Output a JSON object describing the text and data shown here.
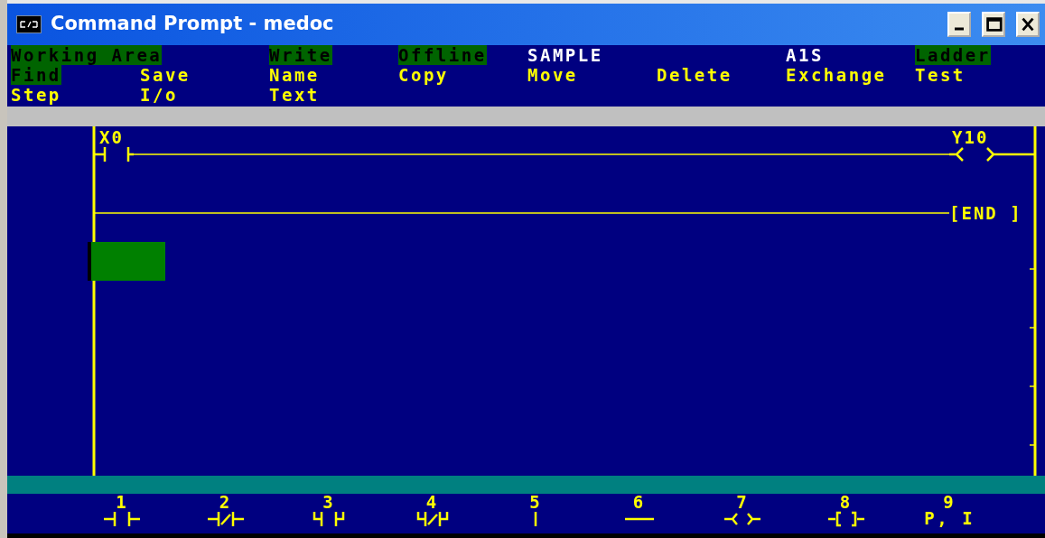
{
  "window": {
    "title": "Command Prompt - medoc"
  },
  "menu_rows": [
    [
      {
        "label": "Working Area",
        "kind": "highlight"
      },
      null,
      {
        "label": "Write",
        "kind": "highlight"
      },
      {
        "label": "Offline",
        "kind": "highlight"
      },
      {
        "label": "SAMPLE",
        "kind": "info"
      },
      null,
      {
        "label": "A1S",
        "kind": "info"
      },
      {
        "label": "Ladder",
        "kind": "highlight"
      }
    ],
    [
      {
        "label": "Find",
        "kind": "highlight"
      },
      {
        "label": "Save",
        "kind": "command"
      },
      {
        "label": "Name",
        "kind": "command"
      },
      {
        "label": "Copy",
        "kind": "command"
      },
      {
        "label": "Move",
        "kind": "command"
      },
      {
        "label": "Delete",
        "kind": "command"
      },
      {
        "label": "Exchange",
        "kind": "command"
      },
      {
        "label": "Test",
        "kind": "command"
      }
    ],
    [
      {
        "label": "Step",
        "kind": "command"
      },
      {
        "label": "I/o",
        "kind": "command"
      },
      {
        "label": "Text",
        "kind": "command"
      },
      null,
      null,
      null,
      null,
      null
    ]
  ],
  "ladder": {
    "rungs": [
      {
        "kind": "coil",
        "contact": "X0",
        "coil": "Y10"
      },
      {
        "kind": "end",
        "instruction": "[END ]"
      }
    ]
  },
  "function_keys": [
    {
      "number": "1",
      "kind": "contact"
    },
    {
      "number": "2",
      "kind": "contact_nc"
    },
    {
      "number": "3",
      "kind": "branch"
    },
    {
      "number": "4",
      "kind": "branch_nc"
    },
    {
      "number": "5",
      "kind": "vertical"
    },
    {
      "number": "6",
      "kind": "horizontal"
    },
    {
      "number": "7",
      "kind": "coil"
    },
    {
      "number": "8",
      "kind": "instruction"
    },
    {
      "number": "9",
      "kind": "text",
      "label": "P, I"
    }
  ]
}
